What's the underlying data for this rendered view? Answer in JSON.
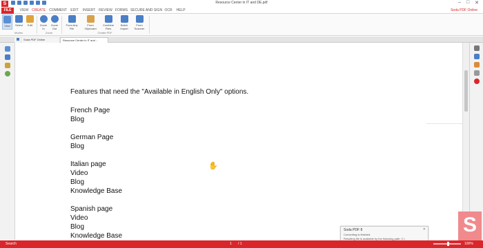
{
  "app": {
    "logo_letter": "S",
    "title": "Resource Center in IT and DE.pdf"
  },
  "window_controls": {
    "minimize": "–",
    "maximize": "□",
    "close": "✕"
  },
  "menu": {
    "tabs": [
      "FILE",
      "VIEW",
      "CREATE",
      "COMMENT",
      "EDIT",
      "INSERT",
      "REVIEW",
      "FORMS",
      "SECURE AND SIGN",
      "OCR",
      "HELP"
    ],
    "active_tab": "CREATE",
    "brand": "Soda PDF Online"
  },
  "ribbon": {
    "buttons": [
      {
        "id": "view",
        "label": "View",
        "icon": "view-icon",
        "color": "#5b8fd3"
      },
      {
        "id": "select",
        "label": "Select",
        "icon": "select-icon",
        "color": "#4a7ec6"
      },
      {
        "id": "edit",
        "label": "Edit",
        "icon": "edit-icon",
        "color": "#e0a33a"
      },
      {
        "id": "zoom-in",
        "label": "Zoom In",
        "icon": "zoom-in-icon",
        "color": "#4a7ec6"
      },
      {
        "id": "zoom-out",
        "label": "Zoom Out",
        "icon": "zoom-out-icon",
        "color": "#4a7ec6"
      },
      {
        "id": "from-any-file",
        "label": "From Any File",
        "icon": "from-file-icon",
        "color": "#4a7ec6"
      },
      {
        "id": "from-clipboard",
        "label": "From Clipboard",
        "icon": "clipboard-icon",
        "color": "#d9a24a"
      },
      {
        "id": "combine-files",
        "label": "Combine Files",
        "icon": "combine-icon",
        "color": "#4a7ec6"
      },
      {
        "id": "batch-import",
        "label": "Batch Import",
        "icon": "batch-icon",
        "color": "#4a7ec6"
      },
      {
        "id": "from-scanner",
        "label": "From Scanner",
        "icon": "scanner-icon",
        "color": "#4a7ec6"
      }
    ],
    "groups": [
      "Modes",
      "Zoom",
      "Create PDF"
    ]
  },
  "doc_tabs": {
    "home_icon": "home-icon",
    "online": "Soda PDF Online",
    "document": "Resource Center in IT and ..."
  },
  "document": {
    "lines": [
      "Features that need the \"Available in English Only\" options.",
      "French Page",
      "Blog",
      "German Page",
      "Blog",
      "Italian page",
      "Video",
      "Blog",
      "Knowledge Base",
      "Spanish page",
      "Video",
      "Blog",
      "Knowledge Base"
    ]
  },
  "notification": {
    "title": "Soda PDF 8",
    "close": "✕",
    "line1": "Converting is finished.",
    "line2": "Resulting file is available by the following path: C:\\",
    "line3": "Users\\Amy\\Desktop\\Resource Center in IT and DE.pdf"
  },
  "status": {
    "search": "Search",
    "page": "1",
    "total": "/ 1",
    "zoom": "100%"
  },
  "colors": {
    "accent": "#d9262b",
    "brand_light": "#f08a8d"
  }
}
